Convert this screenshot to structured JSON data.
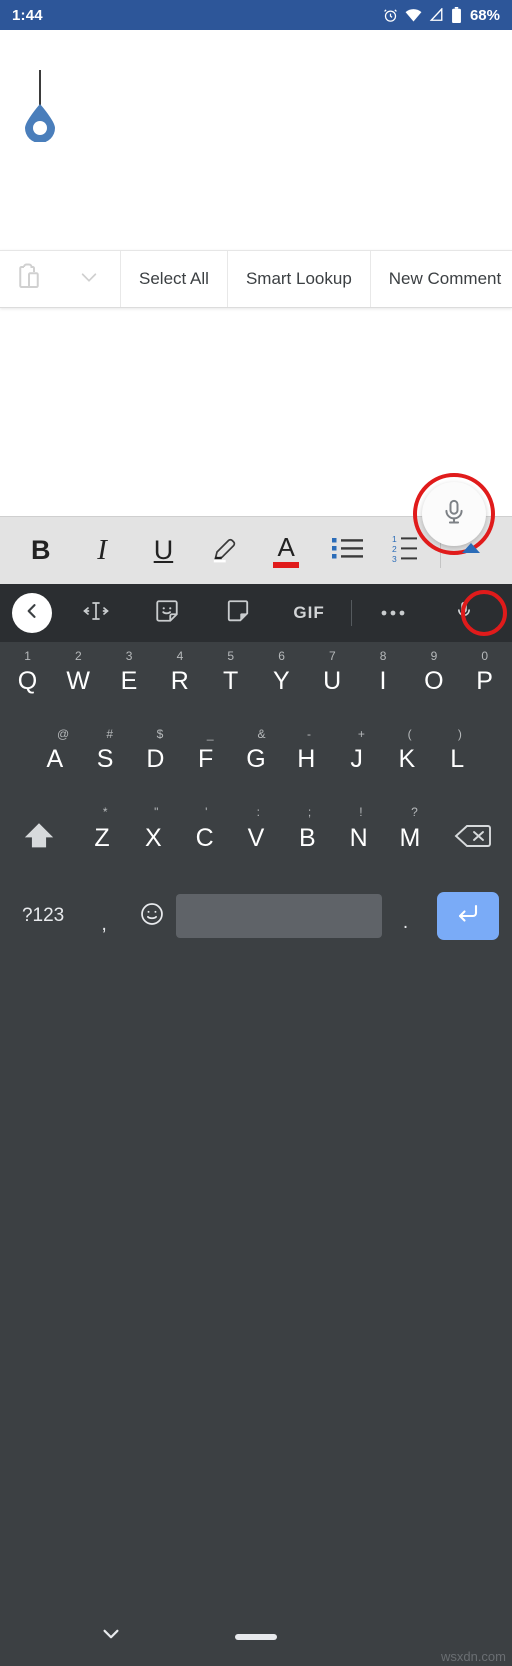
{
  "status_bar": {
    "time": "1:44",
    "battery_percent": "68%",
    "icons": [
      "alarm-icon",
      "wifi-icon",
      "cell-signal-icon",
      "battery-icon"
    ],
    "background_color": "#2d5699",
    "text_color": "#ffffff"
  },
  "document": {
    "caret": "text-caret",
    "selection_handle": "text-selection-handle",
    "handle_color": "#4a7ebb",
    "background_color": "#ffffff"
  },
  "context_menu": {
    "paste_icon": "paste-clipboard-icon",
    "overflow_icon": "chevron-down-icon",
    "items": [
      {
        "label": "Select All",
        "name": "select-all-button"
      },
      {
        "label": "Smart Lookup",
        "name": "smart-lookup-button"
      },
      {
        "label": "New Comment",
        "name": "new-comment-button"
      }
    ]
  },
  "dictate_fab": {
    "icon": "microphone-icon",
    "annotation": "red-circle-highlight",
    "annotation_color": "#e01b1b"
  },
  "format_toolbar": {
    "background_color": "#e3e3e3",
    "buttons": [
      {
        "label": "B",
        "name": "bold-button",
        "icon": "bold-icon"
      },
      {
        "label": "I",
        "name": "italic-button",
        "icon": "italic-icon"
      },
      {
        "label": "U",
        "name": "underline-button",
        "icon": "underline-icon"
      },
      {
        "label": "",
        "name": "highlighter-button",
        "icon": "highlighter-pen-icon"
      },
      {
        "label": "A",
        "name": "font-color-button",
        "icon": "font-color-icon"
      },
      {
        "label": "",
        "name": "bullet-list-button",
        "icon": "bulleted-list-icon"
      },
      {
        "label": "",
        "name": "numbered-list-button",
        "icon": "numbered-list-icon"
      },
      {
        "label": "",
        "name": "expand-toolbar-button",
        "icon": "caret-up-icon"
      }
    ],
    "accent_color": "#2b6cb8",
    "font_color_swatch": "#e01b1b",
    "numbered_list_digits": [
      "1",
      "2",
      "3"
    ]
  },
  "keyboard_toolbar": {
    "background_color": "#2b2e31",
    "items": [
      {
        "name": "expand-toolbar-back-button",
        "icon": "chevron-left-icon"
      },
      {
        "name": "text-editing-button",
        "icon": "text-cursor-icon"
      },
      {
        "name": "sticker-button",
        "icon": "sticker-smiley-icon"
      },
      {
        "name": "translate-button",
        "icon": "translate-card-icon"
      },
      {
        "name": "gif-button",
        "icon": "gif-icon",
        "label": "GIF"
      },
      {
        "name": "more-options-button",
        "icon": "three-dots-icon"
      },
      {
        "name": "voice-input-button",
        "icon": "microphone-icon"
      }
    ],
    "mic_annotation_color": "#e01b1b"
  },
  "keyboard": {
    "background_color": "#3c4043",
    "key_text_color": "#ffffff",
    "alt_text_color": "#b6b9bb",
    "row1": [
      {
        "key": "Q",
        "alt": "1"
      },
      {
        "key": "W",
        "alt": "2"
      },
      {
        "key": "E",
        "alt": "3"
      },
      {
        "key": "R",
        "alt": "4"
      },
      {
        "key": "T",
        "alt": "5"
      },
      {
        "key": "Y",
        "alt": "6"
      },
      {
        "key": "U",
        "alt": "7"
      },
      {
        "key": "I",
        "alt": "8"
      },
      {
        "key": "O",
        "alt": "9"
      },
      {
        "key": "P",
        "alt": "0"
      }
    ],
    "row2": [
      {
        "key": "A",
        "alt": "@"
      },
      {
        "key": "S",
        "alt": "#"
      },
      {
        "key": "D",
        "alt": "$"
      },
      {
        "key": "F",
        "alt": "_"
      },
      {
        "key": "G",
        "alt": "&"
      },
      {
        "key": "H",
        "alt": "-"
      },
      {
        "key": "J",
        "alt": "+"
      },
      {
        "key": "K",
        "alt": "("
      },
      {
        "key": "L",
        "alt": ")"
      }
    ],
    "row3": {
      "shift": {
        "name": "shift-key",
        "icon": "shift-arrow-icon"
      },
      "letters": [
        {
          "key": "Z",
          "alt": "*"
        },
        {
          "key": "X",
          "alt": "\""
        },
        {
          "key": "C",
          "alt": "'"
        },
        {
          "key": "V",
          "alt": ":"
        },
        {
          "key": "B",
          "alt": ";"
        },
        {
          "key": "N",
          "alt": "!"
        },
        {
          "key": "M",
          "alt": "?"
        }
      ],
      "backspace": {
        "name": "backspace-key",
        "icon": "backspace-icon"
      }
    },
    "row4": {
      "symbols_label": "?123",
      "comma": ",",
      "emoji_icon": "emoji-smiley-icon",
      "space_label": "",
      "period": ".",
      "enter_icon": "enter-return-icon",
      "enter_color": "#7aabf7",
      "space_color": "#5f6368"
    }
  },
  "nav_bar": {
    "background_color": "#3c4043",
    "hide_keyboard_icon": "chevron-down-icon",
    "home_pill": "home-gesture-pill"
  },
  "watermark": {
    "text": "wsxdn.com"
  }
}
